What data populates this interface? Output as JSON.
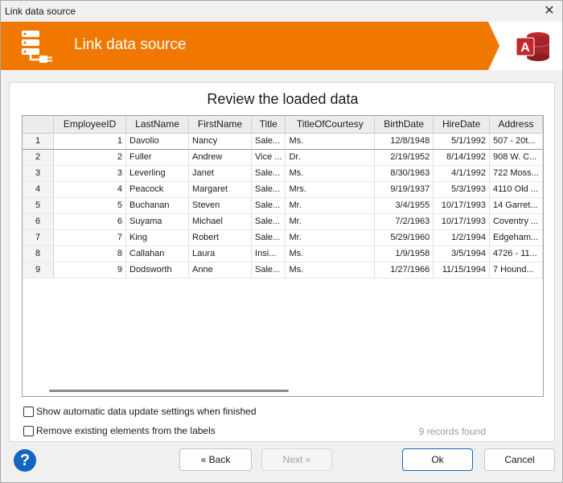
{
  "window": {
    "title": "Link data source",
    "close_glyph": "✕"
  },
  "banner": {
    "heading": "Link data source",
    "icon": "database-plug-icon",
    "app_icon": "access-app-icon",
    "app_icon_letter": "A",
    "accent_color": "#f07800"
  },
  "main": {
    "subtitle": "Review the loaded data",
    "columns": [
      "",
      "EmployeeID",
      "LastName",
      "FirstName",
      "Title",
      "TitleOfCourtesy",
      "BirthDate",
      "HireDate",
      "Address"
    ],
    "rows": [
      [
        "1",
        "1",
        "Davolio",
        "Nancy",
        "Sale...",
        "Ms.",
        "12/8/1948",
        "5/1/1992",
        "507 - 20t..."
      ],
      [
        "2",
        "2",
        "Fuller",
        "Andrew",
        "Vice ...",
        "Dr.",
        "2/19/1952",
        "8/14/1992",
        "908 W. C..."
      ],
      [
        "3",
        "3",
        "Leverling",
        "Janet",
        "Sale...",
        "Ms.",
        "8/30/1963",
        "4/1/1992",
        "722 Moss..."
      ],
      [
        "4",
        "4",
        "Peacock",
        "Margaret",
        "Sale...",
        "Mrs.",
        "9/19/1937",
        "5/3/1993",
        "4110 Old ..."
      ],
      [
        "5",
        "5",
        "Buchanan",
        "Steven",
        "Sale...",
        "Mr.",
        "3/4/1955",
        "10/17/1993",
        "14 Garret..."
      ],
      [
        "6",
        "6",
        "Suyama",
        "Michael",
        "Sale...",
        "Mr.",
        "7/2/1963",
        "10/17/1993",
        "Coventry ..."
      ],
      [
        "7",
        "7",
        "King",
        "Robert",
        "Sale...",
        "Mr.",
        "5/29/1960",
        "1/2/1994",
        "Edgeham..."
      ],
      [
        "8",
        "8",
        "Callahan",
        "Laura",
        "Insi...",
        "Ms.",
        "1/9/1958",
        "3/5/1994",
        "4726 - 11..."
      ],
      [
        "9",
        "9",
        "Dodsworth",
        "Anne",
        "Sale...",
        "Ms.",
        "1/27/1966",
        "11/15/1994",
        "7 Hound..."
      ]
    ],
    "options": {
      "show_auto_update": {
        "label": "Show automatic data update settings when finished",
        "checked": false
      },
      "remove_existing": {
        "label": "Remove existing elements from the labels",
        "checked": false
      }
    },
    "records_found": "9 records found"
  },
  "footer": {
    "help_glyph": "?",
    "back_label": "« Back",
    "next_label": "Next »",
    "ok_label": "Ok",
    "cancel_label": "Cancel"
  }
}
